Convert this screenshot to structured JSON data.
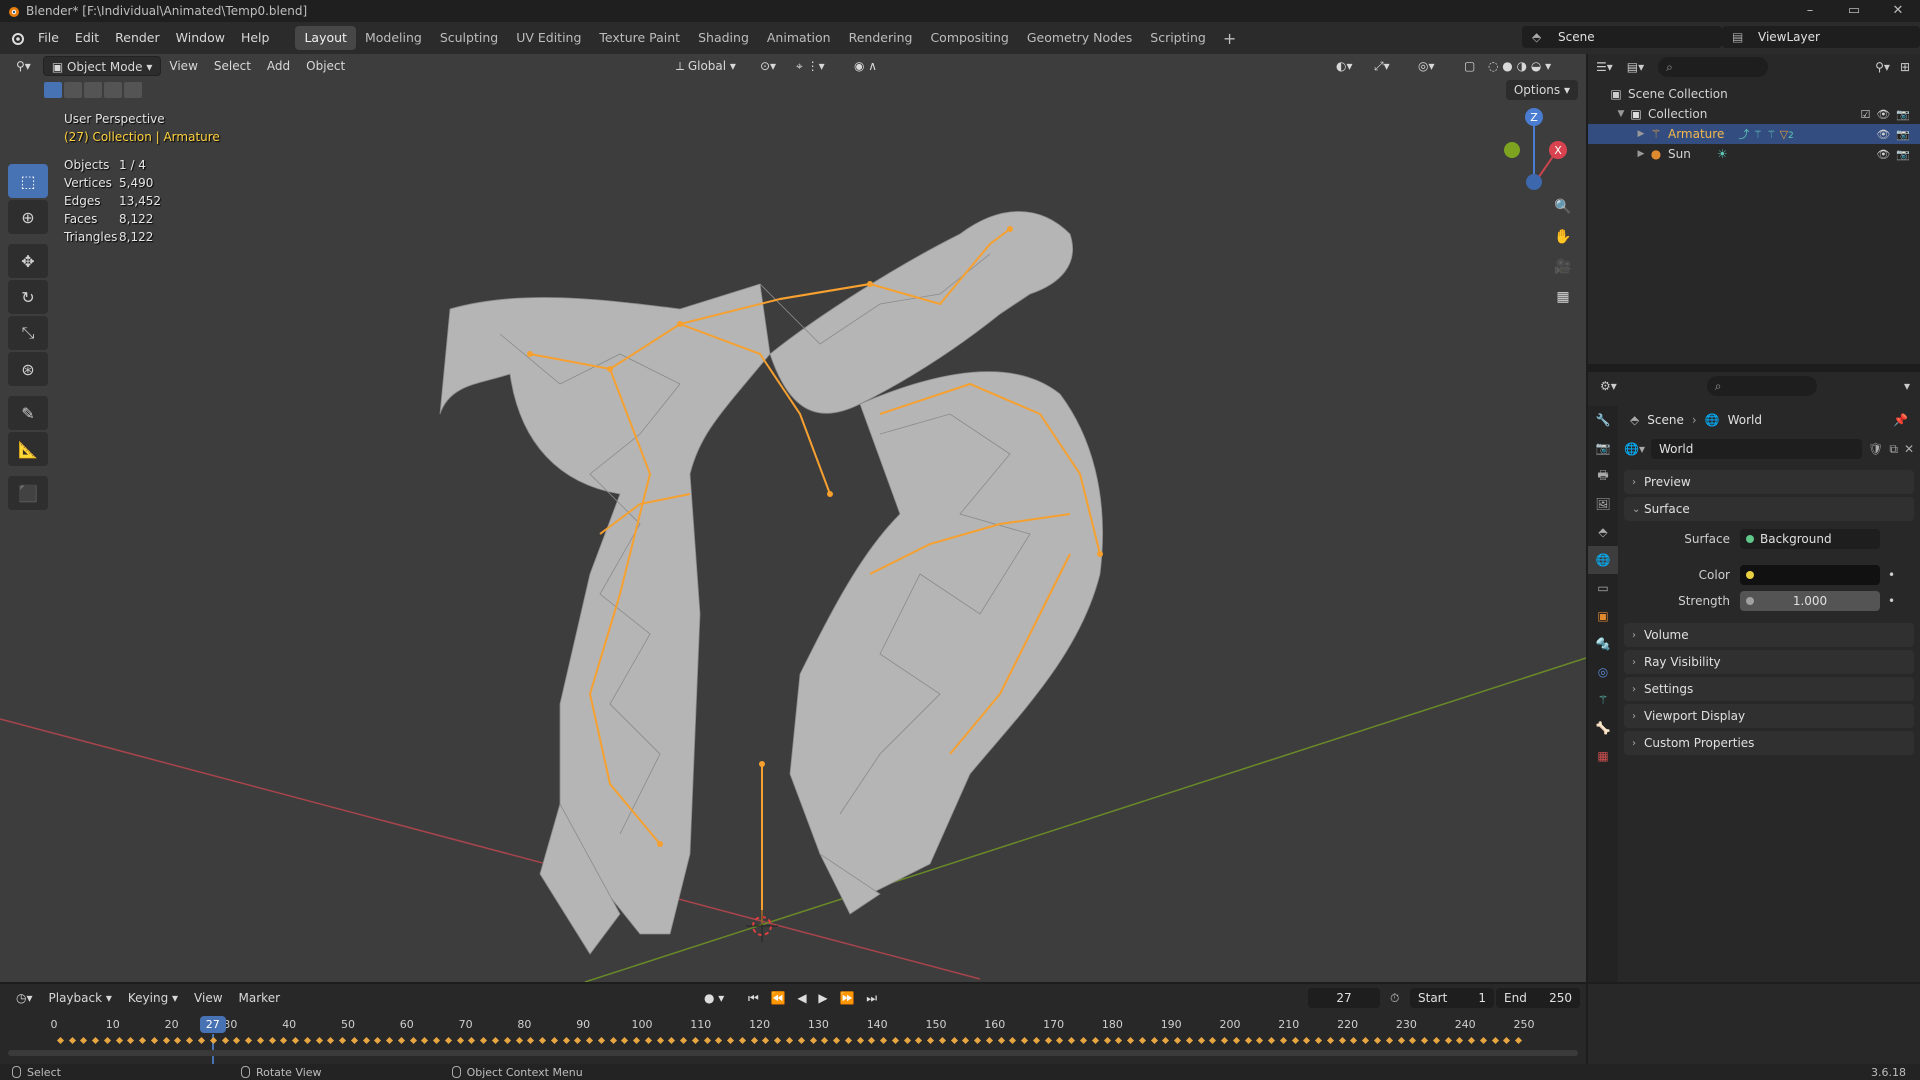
{
  "window": {
    "title": "Blender* [F:\\Individual\\Animated\\Temp0.blend]",
    "controls": [
      "–",
      "▭",
      "✕"
    ]
  },
  "menu": {
    "items": [
      "File",
      "Edit",
      "Render",
      "Window",
      "Help"
    ],
    "workspaces": [
      "Layout",
      "Modeling",
      "Sculpting",
      "UV Editing",
      "Texture Paint",
      "Shading",
      "Animation",
      "Rendering",
      "Compositing",
      "Geometry Nodes",
      "Scripting"
    ],
    "active_workspace": "Layout",
    "add_tab": "+",
    "scene": "Scene",
    "view_layer": "ViewLayer"
  },
  "viewport": {
    "mode": "Object Mode",
    "header_menus": [
      "View",
      "Select",
      "Add",
      "Object"
    ],
    "orientation": "Global",
    "options_label": "Options",
    "perspective": "User Perspective",
    "context": "(27) Collection | Armature",
    "stats": [
      {
        "label": "Objects",
        "value": "1 / 4"
      },
      {
        "label": "Vertices",
        "value": "5,490"
      },
      {
        "label": "Edges",
        "value": "13,452"
      },
      {
        "label": "Faces",
        "value": "8,122"
      },
      {
        "label": "Triangles",
        "value": "8,122"
      }
    ],
    "gizmo": {
      "z": "Z",
      "x": "X"
    },
    "colors": {
      "bg": "#3d3d3d",
      "bone": "#f6a030",
      "mesh": "#b9b9b9",
      "x_axis": "#b8464d",
      "y_axis": "#6f8c2a"
    }
  },
  "outliner": {
    "root": "Scene Collection",
    "collection": "Collection",
    "items": [
      {
        "name": "Armature",
        "selected": true,
        "badge": "2"
      },
      {
        "name": "Sun",
        "selected": false
      }
    ]
  },
  "properties": {
    "breadcrumb": [
      "Scene",
      "World"
    ],
    "world_name": "World",
    "panels": {
      "preview": "Preview",
      "surface": "Surface",
      "volume": "Volume",
      "ray_visibility": "Ray Visibility",
      "settings": "Settings",
      "viewport_display": "Viewport Display",
      "custom_properties": "Custom Properties"
    },
    "surface": {
      "surface_label": "Surface",
      "surface_value": "Background",
      "color_label": "Color",
      "color_value": "#111111",
      "strength_label": "Strength",
      "strength_value": "1.000"
    }
  },
  "timeline": {
    "menus": [
      "Playback",
      "Keying",
      "View",
      "Marker"
    ],
    "current_frame": "27",
    "start_label": "Start",
    "start": "1",
    "end_label": "End",
    "end": "250",
    "ticks": [
      "0",
      "10",
      "20",
      "30",
      "40",
      "50",
      "60",
      "70",
      "80",
      "90",
      "100",
      "110",
      "120",
      "130",
      "140",
      "150",
      "160",
      "170",
      "180",
      "190",
      "200",
      "210",
      "220",
      "230",
      "240",
      "250"
    ]
  },
  "status": {
    "select": "Select",
    "rotate": "Rotate View",
    "context_menu": "Object Context Menu",
    "version": "3.6.18"
  }
}
